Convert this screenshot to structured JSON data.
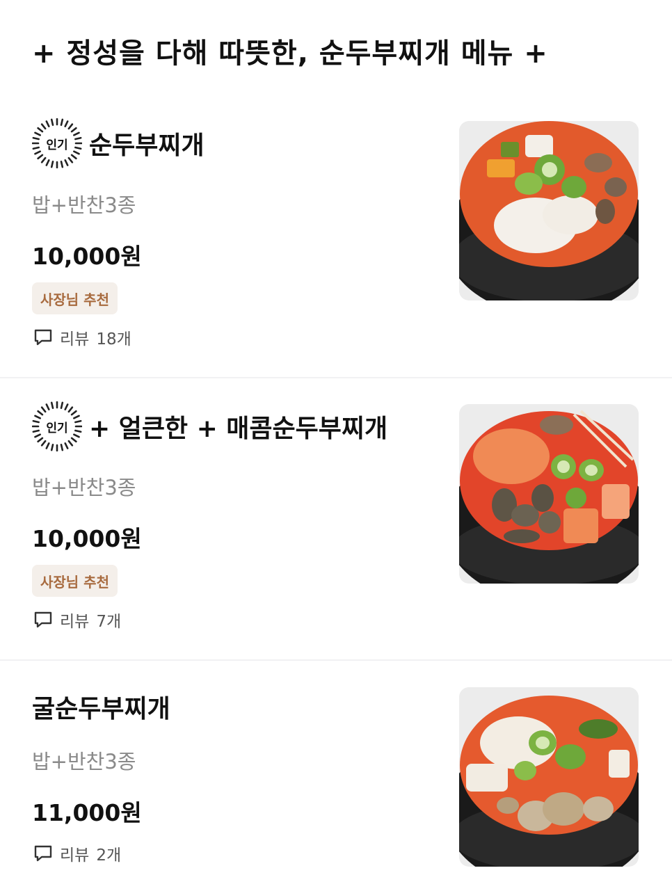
{
  "section_title": "+ 정성을 다해 따뜻한, 순두부찌개 메뉴 +",
  "popular_label": "인기",
  "recommend_label": "사장님 추천",
  "items": [
    {
      "name": "순두부찌개",
      "popular": true,
      "description": "밥+반찬3종",
      "price": "10,000원",
      "recommended": true,
      "review_label": "리뷰",
      "review_count": "18개",
      "photo": "soft-tofu-stew-photo"
    },
    {
      "name": "+ 얼큰한 + 매콤순두부찌개",
      "popular": true,
      "description": "밥+반찬3종",
      "price": "10,000원",
      "recommended": true,
      "review_label": "리뷰",
      "review_count": "7개",
      "photo": "spicy-tofu-stew-photo"
    },
    {
      "name": "굴순두부찌개",
      "popular": false,
      "description": "밥+반찬3종",
      "price": "11,000원",
      "recommended": false,
      "review_label": "리뷰",
      "review_count": "2개",
      "photo": "oyster-tofu-stew-photo"
    }
  ],
  "colors": {
    "recommend_bg": "#f4efea",
    "recommend_text": "#a86b3f",
    "description_text": "#8a8a8a",
    "stew_broth": "#e0502a",
    "pot": "#1c1c1c"
  }
}
